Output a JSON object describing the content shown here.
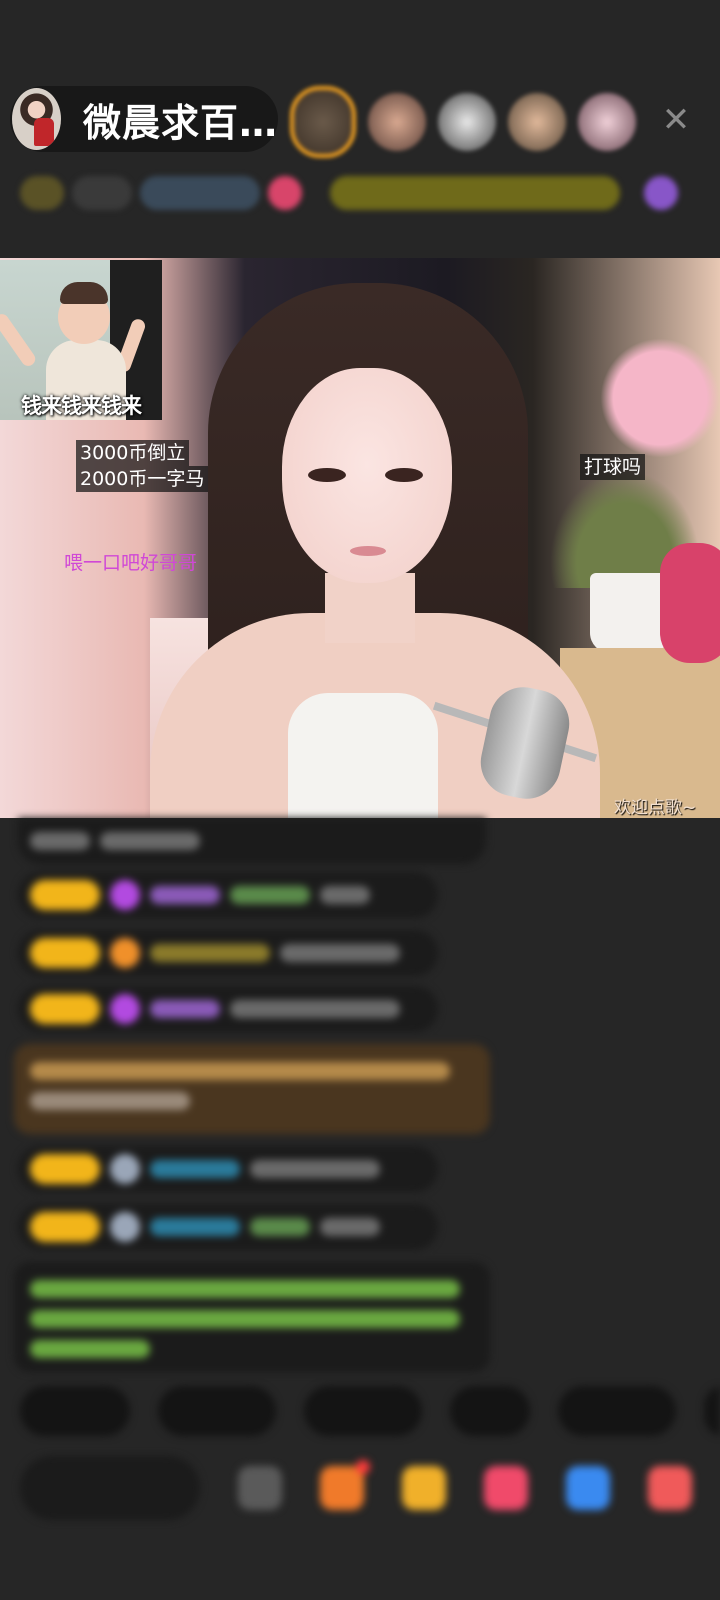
{
  "header": {
    "host_name": "微晨求百…",
    "close_icon": "close-icon"
  },
  "overlays": {
    "meme_caption": "钱来钱来钱来",
    "price_line_1": "3000币倒立",
    "price_line_2": "2000币一字马",
    "feed_text": "喂一口吧好哥哥",
    "ball_text": "打球吗",
    "song_text": "欢迎点歌~"
  },
  "colors": {
    "background": "#262626",
    "badge_gold": "#f2b51a",
    "feed_text_purple": "#d048d6"
  }
}
